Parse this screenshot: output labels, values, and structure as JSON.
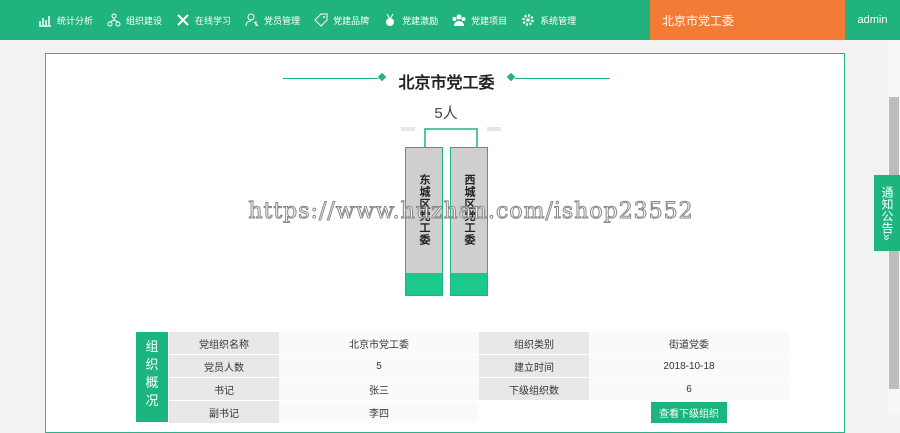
{
  "nav": {
    "items": [
      {
        "label": "统计分析",
        "icon": "chart-icon"
      },
      {
        "label": "组织建设",
        "icon": "org-tree-icon"
      },
      {
        "label": "在线学习",
        "icon": "tools-icon"
      },
      {
        "label": "党员管理",
        "icon": "member-icon"
      },
      {
        "label": "党建品牌",
        "icon": "tag-icon"
      },
      {
        "label": "党建激励",
        "icon": "medal-icon"
      },
      {
        "label": "党建项目",
        "icon": "group-icon"
      },
      {
        "label": "系统管理",
        "icon": "gear-icon"
      }
    ],
    "current_org": "北京市党工委",
    "user": "admin"
  },
  "main": {
    "title": "北京市党工委",
    "member_count": "5人",
    "sub_orgs": [
      "东城区党工委",
      "西城区党工委"
    ],
    "watermark": "https://www.huzhan.com/ishop23552"
  },
  "overview": {
    "side_label": [
      "组",
      "织",
      "概",
      "况"
    ],
    "rows": [
      {
        "k1": "党组织名称",
        "v1": "北京市党工委",
        "k2": "组织类别",
        "v2": "街道党委"
      },
      {
        "k1": "党员人数",
        "v1": "5",
        "k2": "建立时间",
        "v2": "2018-10-18"
      },
      {
        "k1": "书记",
        "v1": "张三",
        "k2": "下级组织数",
        "v2": "6"
      },
      {
        "k1": "副书记",
        "v1": "李四",
        "k2": "",
        "v2": ""
      }
    ],
    "view_sub_button": "查看下级组织"
  },
  "notice": {
    "label": "通知公告",
    "arrow": "»"
  },
  "colors": {
    "primary": "#20b37e",
    "accent": "#f47b36",
    "card": "#cfcfcf"
  }
}
